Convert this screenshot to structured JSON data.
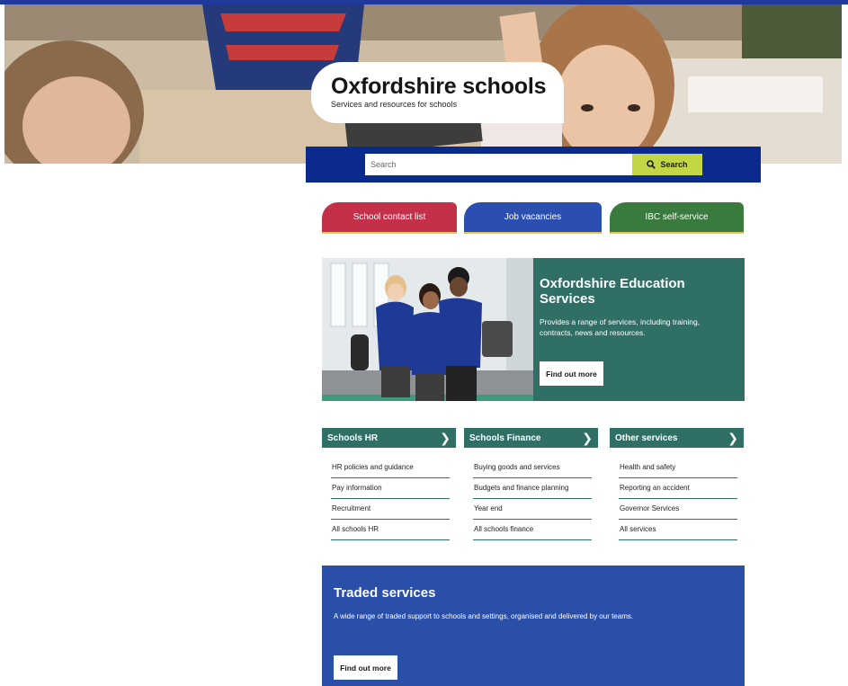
{
  "header": {
    "title": "Oxfordshire schools",
    "subtitle": "Services and resources for schools"
  },
  "search": {
    "placeholder": "Search",
    "button_label": "Search"
  },
  "quick_links": [
    {
      "label": "School contact list",
      "color": "#c4304a"
    },
    {
      "label": "Job vacancies",
      "color": "#2a4fb0"
    },
    {
      "label": "IBC self-service",
      "color": "#3b7a3e"
    }
  ],
  "promo": {
    "title": "Oxfordshire Education Services",
    "description": "Provides a range of services, including training, contracts, news and resources.",
    "button_label": "Find out more"
  },
  "columns": [
    {
      "heading": "Schools HR",
      "links": [
        "HR policies and guidance",
        "Pay information",
        "Recruitment",
        "All schools HR"
      ]
    },
    {
      "heading": "Schools Finance",
      "links": [
        "Buying goods and services",
        "Budgets and finance planning",
        "Year end",
        "All schools finance"
      ]
    },
    {
      "heading": "Other services",
      "links": [
        "Health and safety",
        "Reporting an accident",
        "Governor Services",
        "All services"
      ]
    }
  ],
  "traded": {
    "title": "Traded services",
    "description": "A wide range of traded support to schools and settings, organised and delivered by our teams.",
    "button_label": "Find out more"
  },
  "colors": {
    "brand_blue": "#0b2a8f",
    "teal": "#2f6f66",
    "search_button": "#c3d645",
    "traded_blue": "#2a4fa8"
  }
}
